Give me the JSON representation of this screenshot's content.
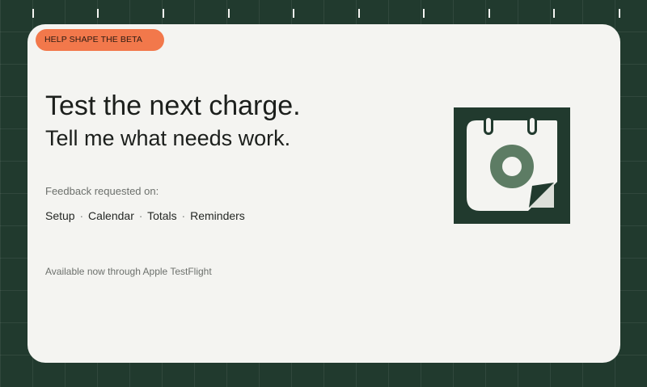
{
  "badge": "HELP SHAPE THE BETA",
  "headline": "Test the next charge.",
  "subheadline": "Tell me what needs work.",
  "feedback_label": "Feedback requested on:",
  "topics": [
    "Setup",
    "Calendar",
    "Totals",
    "Reminders"
  ],
  "separator": "·",
  "availability": "Available now through Apple TestFlight",
  "icon": "calendar-icon",
  "colors": {
    "background": "#213a2e",
    "card": "#f4f4f1",
    "accent": "#f2784b",
    "icon_ring": "#5d7c64"
  }
}
